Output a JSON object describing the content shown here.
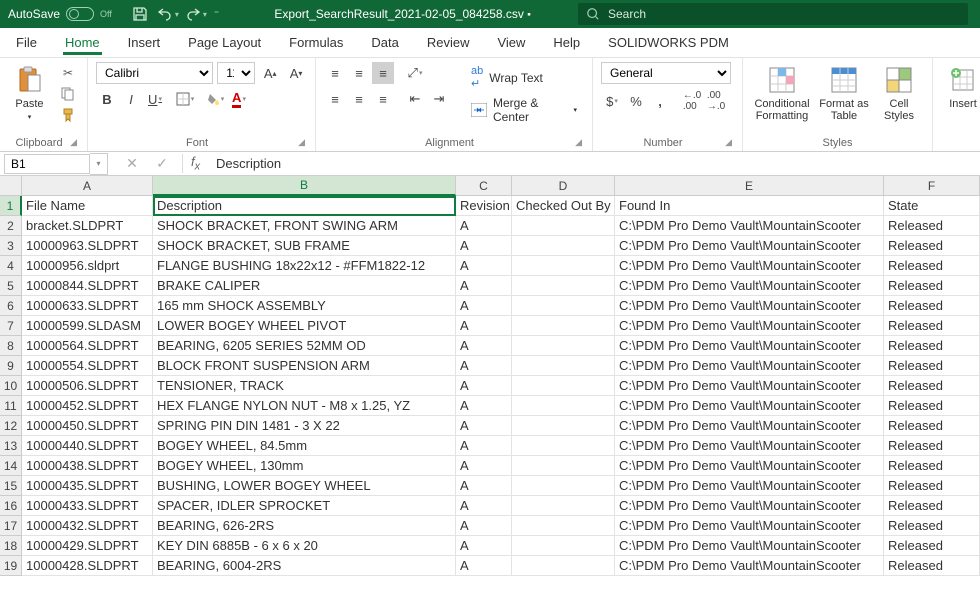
{
  "title": {
    "autosave": "AutoSave",
    "autosave_state": "Off",
    "doc": "Export_SearchResult_2021-02-05_084258.csv",
    "status": "▪"
  },
  "search": {
    "placeholder": "Search"
  },
  "menu": [
    "File",
    "Home",
    "Insert",
    "Page Layout",
    "Formulas",
    "Data",
    "Review",
    "View",
    "Help",
    "SOLIDWORKS PDM"
  ],
  "menu_active": 1,
  "ribbon": {
    "clipboard": {
      "label": "Clipboard",
      "paste": "Paste"
    },
    "font": {
      "label": "Font",
      "name": "Calibri",
      "size": "11"
    },
    "align": {
      "label": "Alignment",
      "wrap": "Wrap Text",
      "merge": "Merge & Center"
    },
    "number": {
      "label": "Number",
      "format": "General"
    },
    "styles": {
      "label": "Styles",
      "cond": "Conditional Formatting",
      "table": "Format as Table",
      "cell": "Cell Styles"
    },
    "insert": "Insert"
  },
  "namebox": "B1",
  "formula": "Description",
  "columns": [
    "A",
    "B",
    "C",
    "D",
    "E",
    "F"
  ],
  "headers": {
    "A": "File Name",
    "B": "Description",
    "C": "Revision",
    "D": "Checked Out By",
    "E": "Found In",
    "F": "State"
  },
  "rows": [
    {
      "A": "bracket.SLDPRT",
      "B": "SHOCK BRACKET, FRONT SWING ARM",
      "C": "A",
      "D": "",
      "E": "C:\\PDM Pro Demo Vault\\MountainScooter",
      "F": "Released"
    },
    {
      "A": "10000963.SLDPRT",
      "B": "SHOCK BRACKET, SUB FRAME",
      "C": "A",
      "D": "",
      "E": "C:\\PDM Pro Demo Vault\\MountainScooter",
      "F": "Released"
    },
    {
      "A": "10000956.sldprt",
      "B": "FLANGE BUSHING 18x22x12 - #FFM1822-12",
      "C": "A",
      "D": "",
      "E": "C:\\PDM Pro Demo Vault\\MountainScooter",
      "F": "Released"
    },
    {
      "A": "10000844.SLDPRT",
      "B": "BRAKE CALIPER",
      "C": "A",
      "D": "",
      "E": "C:\\PDM Pro Demo Vault\\MountainScooter",
      "F": "Released"
    },
    {
      "A": "10000633.SLDPRT",
      "B": "165 mm SHOCK ASSEMBLY",
      "C": "A",
      "D": "",
      "E": "C:\\PDM Pro Demo Vault\\MountainScooter",
      "F": "Released"
    },
    {
      "A": "10000599.SLDASM",
      "B": "LOWER BOGEY WHEEL PIVOT",
      "C": "A",
      "D": "",
      "E": "C:\\PDM Pro Demo Vault\\MountainScooter",
      "F": "Released"
    },
    {
      "A": "10000564.SLDPRT",
      "B": "BEARING, 6205 SERIES 52MM OD",
      "C": "A",
      "D": "",
      "E": "C:\\PDM Pro Demo Vault\\MountainScooter",
      "F": "Released"
    },
    {
      "A": "10000554.SLDPRT",
      "B": "BLOCK FRONT SUSPENSION ARM",
      "C": "A",
      "D": "",
      "E": "C:\\PDM Pro Demo Vault\\MountainScooter",
      "F": "Released"
    },
    {
      "A": "10000506.SLDPRT",
      "B": "TENSIONER, TRACK",
      "C": "A",
      "D": "",
      "E": "C:\\PDM Pro Demo Vault\\MountainScooter",
      "F": "Released"
    },
    {
      "A": "10000452.SLDPRT",
      "B": "HEX FLANGE NYLON NUT - M8 x 1.25, YZ",
      "C": "A",
      "D": "",
      "E": "C:\\PDM Pro Demo Vault\\MountainScooter",
      "F": "Released"
    },
    {
      "A": "10000450.SLDPRT",
      "B": "SPRING PIN DIN 1481 - 3 X 22",
      "C": "A",
      "D": "",
      "E": "C:\\PDM Pro Demo Vault\\MountainScooter",
      "F": "Released"
    },
    {
      "A": "10000440.SLDPRT",
      "B": "BOGEY WHEEL, 84.5mm",
      "C": "A",
      "D": "",
      "E": "C:\\PDM Pro Demo Vault\\MountainScooter",
      "F": "Released"
    },
    {
      "A": "10000438.SLDPRT",
      "B": "BOGEY WHEEL, 130mm",
      "C": "A",
      "D": "",
      "E": "C:\\PDM Pro Demo Vault\\MountainScooter",
      "F": "Released"
    },
    {
      "A": "10000435.SLDPRT",
      "B": "BUSHING, LOWER BOGEY WHEEL",
      "C": "A",
      "D": "",
      "E": "C:\\PDM Pro Demo Vault\\MountainScooter",
      "F": "Released"
    },
    {
      "A": "10000433.SLDPRT",
      "B": "SPACER, IDLER SPROCKET",
      "C": "A",
      "D": "",
      "E": "C:\\PDM Pro Demo Vault\\MountainScooter",
      "F": "Released"
    },
    {
      "A": "10000432.SLDPRT",
      "B": "BEARING, 626-2RS",
      "C": "A",
      "D": "",
      "E": "C:\\PDM Pro Demo Vault\\MountainScooter",
      "F": "Released"
    },
    {
      "A": "10000429.SLDPRT",
      "B": "KEY DIN 6885B - 6 x 6 x 20",
      "C": "A",
      "D": "",
      "E": "C:\\PDM Pro Demo Vault\\MountainScooter",
      "F": "Released"
    },
    {
      "A": "10000428.SLDPRT",
      "B": "BEARING, 6004-2RS",
      "C": "A",
      "D": "",
      "E": "C:\\PDM Pro Demo Vault\\MountainScooter",
      "F": "Released"
    }
  ]
}
